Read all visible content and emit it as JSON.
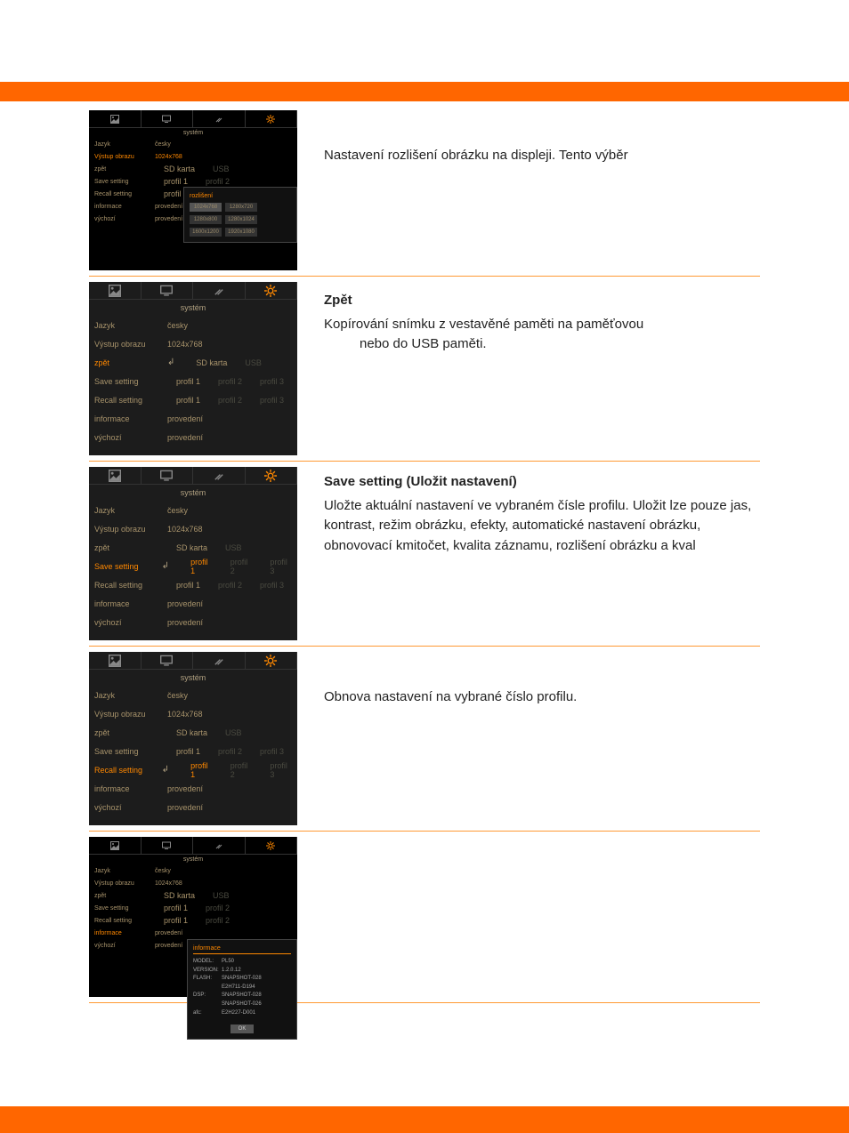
{
  "sections": [
    {
      "desc_title": "",
      "desc_body": "Nastavení rozlišení obrázku na displeji. Tento výběr",
      "highlight_row": "výstup_obrazu",
      "popup": "res"
    },
    {
      "desc_title": "Zpět",
      "desc_body": "Kopírování snímku z vestavěné paměti na paměťovou",
      "desc_indent": "nebo do USB paměti.",
      "highlight_row": "zpět"
    },
    {
      "desc_title": "Save setting (Uložit nastavení)",
      "desc_body": "Uložte aktuální nastavení ve vybraném čísle profilu. Uložit lze pouze jas, kontrast, režim obrázku, efekty, automatické nastavení obrázku, obnovovací kmitočet, kvalita záznamu, rozlišení obrázku a kval",
      "highlight_row": "save"
    },
    {
      "desc_title": "",
      "desc_body": "Obnova nastavení na vybrané číslo profilu.",
      "highlight_row": "recall"
    },
    {
      "desc_title": "",
      "desc_body": "",
      "highlight_row": "informace",
      "popup": "info"
    }
  ],
  "menu": {
    "title": "systém",
    "rows": {
      "jazyk": {
        "label": "Jazyk",
        "value": "česky"
      },
      "výstup_obrazu": {
        "label": "Výstup obrazu",
        "value": "1024x768"
      },
      "zpět": {
        "label": "zpět",
        "opts": [
          "SD karta",
          "USB"
        ]
      },
      "save": {
        "label": "Save setting",
        "opts": [
          "profil 1",
          "profil 2",
          "profil 3"
        ]
      },
      "recall": {
        "label": "Recall setting",
        "opts": [
          "profil 1",
          "profil 2",
          "profil 3"
        ]
      },
      "informace": {
        "label": "informace",
        "value": "provedení"
      },
      "výchozí": {
        "label": "výchozí",
        "value": "provedení"
      }
    }
  },
  "res_popup": {
    "title": "rozlišení",
    "opts": [
      "1024x768",
      "1280x720",
      "1280x800",
      "1280x1024",
      "1600x1200",
      "1920x1080"
    ]
  },
  "info_popup": {
    "title": "informace",
    "items": [
      {
        "k": "MODEL:",
        "v": "PL50"
      },
      {
        "k": "VERSION:",
        "v": "1.2.0.12"
      },
      {
        "k": "FLASH:",
        "v": "SNAPSHOT-028"
      },
      {
        "k": "",
        "v": "E2H711-D194"
      },
      {
        "k": "DSP:",
        "v": "SNAPSHOT-028"
      },
      {
        "k": "",
        "v": "SNAPSHOT-026"
      },
      {
        "k": "afc:",
        "v": "E2H227-D001"
      }
    ],
    "ok": "OK"
  }
}
